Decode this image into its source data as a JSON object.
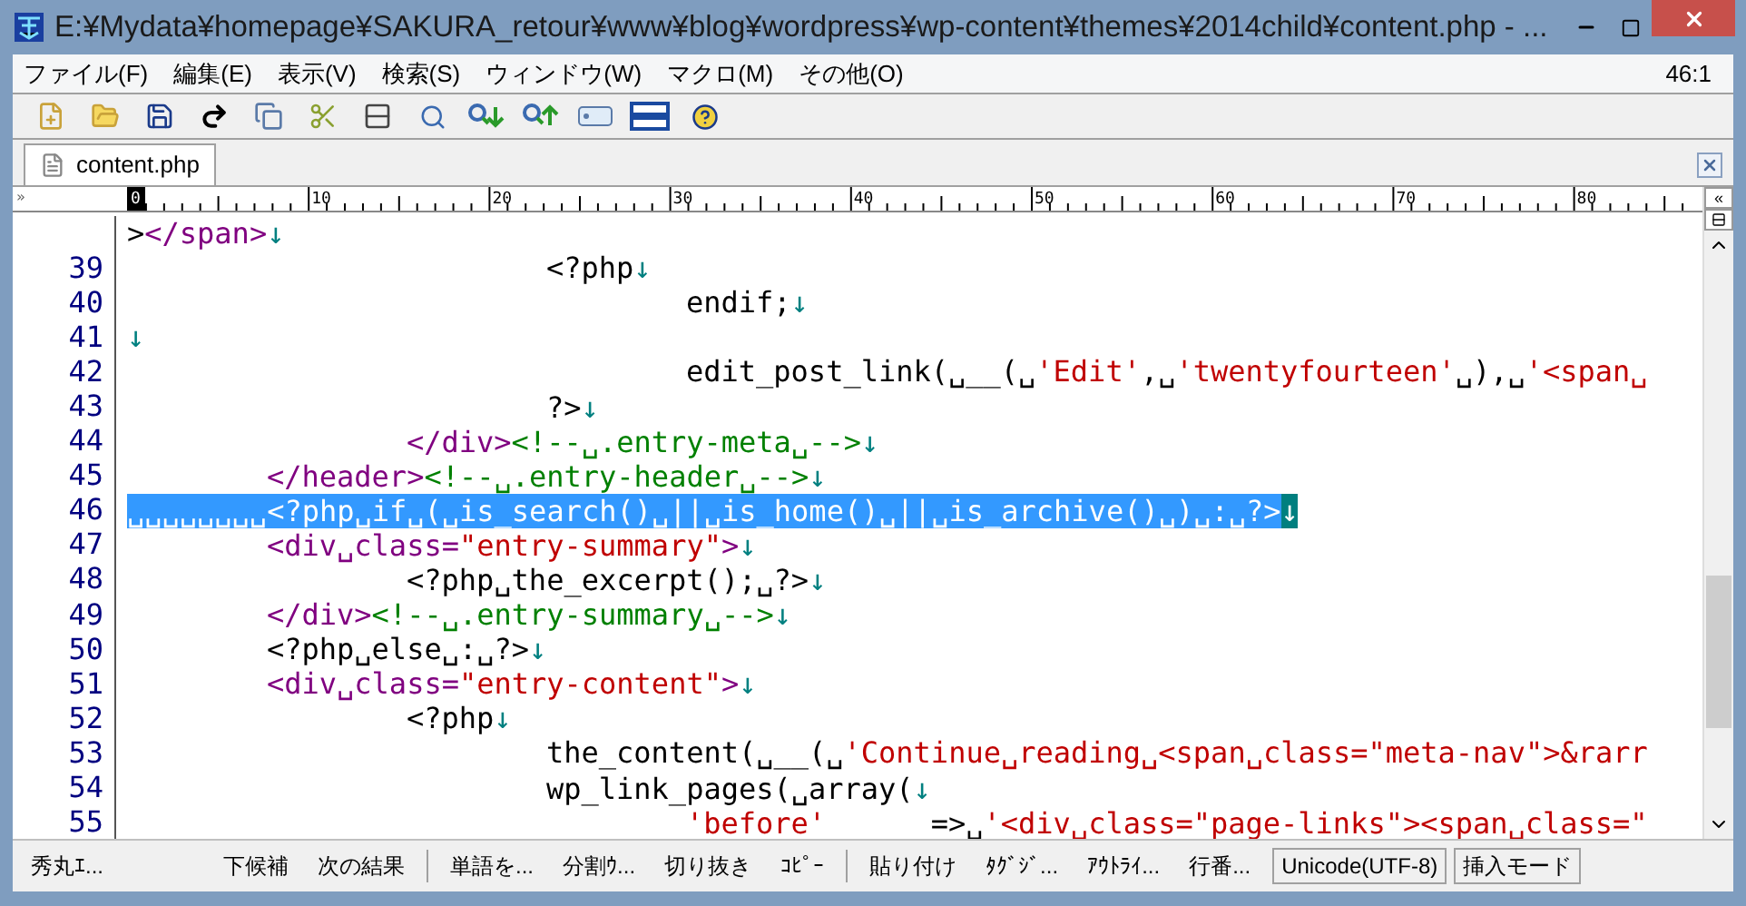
{
  "window": {
    "title": "E:¥Mydata¥homepage¥SAKURA_retour¥www¥blog¥wordpress¥wp-content¥themes¥2014child¥content.php  - ..."
  },
  "menu": [
    "ファイル(F)",
    "編集(E)",
    "表示(V)",
    "検索(S)",
    "ウィンドウ(W)",
    "マクロ(M)",
    "その他(O)"
  ],
  "cursor_position": "46:1",
  "tabs": [
    {
      "label": "content.php",
      "selected": true
    }
  ],
  "ruler": {
    "left_marker": "»",
    "collapse_marker": "«",
    "labels": [
      "0",
      "10",
      "20",
      "30",
      "40",
      "50",
      "60",
      "70",
      "80"
    ]
  },
  "lines": [
    {
      "selected": false,
      "segments": [
        {
          "kind": "plain",
          "text": ">"
        },
        {
          "kind": "tag",
          "text": "</span>"
        },
        {
          "kind": "eol",
          "text": "↓"
        }
      ]
    },
    {
      "number": "39",
      "selected": false,
      "segments": [
        {
          "kind": "tab"
        },
        {
          "kind": "tab"
        },
        {
          "kind": "tab"
        },
        {
          "kind": "plain",
          "text": "<?php"
        },
        {
          "kind": "eol",
          "text": "↓"
        }
      ]
    },
    {
      "number": "40",
      "selected": false,
      "segments": [
        {
          "kind": "tab"
        },
        {
          "kind": "tab"
        },
        {
          "kind": "tab"
        },
        {
          "kind": "tab"
        },
        {
          "kind": "plain",
          "text": "endif;"
        },
        {
          "kind": "eol",
          "text": "↓"
        }
      ]
    },
    {
      "number": "41",
      "selected": false,
      "segments": [
        {
          "kind": "eol",
          "text": "↓"
        }
      ]
    },
    {
      "number": "42",
      "selected": false,
      "segments": [
        {
          "kind": "tab"
        },
        {
          "kind": "tab"
        },
        {
          "kind": "tab"
        },
        {
          "kind": "tab"
        },
        {
          "kind": "plain",
          "text": "edit_post_link(␣__(␣"
        },
        {
          "kind": "string",
          "text": "'Edit'"
        },
        {
          "kind": "plain",
          "text": ",␣"
        },
        {
          "kind": "string",
          "text": "'twentyfourteen'"
        },
        {
          "kind": "plain",
          "text": "␣),␣"
        },
        {
          "kind": "string",
          "text": "'<span␣"
        }
      ]
    },
    {
      "number": "43",
      "selected": false,
      "segments": [
        {
          "kind": "tab"
        },
        {
          "kind": "tab"
        },
        {
          "kind": "tab"
        },
        {
          "kind": "plain",
          "text": "?>"
        },
        {
          "kind": "eol",
          "text": "↓"
        }
      ]
    },
    {
      "number": "44",
      "selected": false,
      "segments": [
        {
          "kind": "tab"
        },
        {
          "kind": "tab"
        },
        {
          "kind": "tag",
          "text": "</div>"
        },
        {
          "kind": "comment",
          "text": "<!--␣.entry-meta␣-->"
        },
        {
          "kind": "eol",
          "text": "↓"
        }
      ]
    },
    {
      "number": "45",
      "selected": false,
      "segments": [
        {
          "kind": "tab"
        },
        {
          "kind": "tag",
          "text": "</header>"
        },
        {
          "kind": "comment",
          "text": "<!--␣.entry-header␣-->"
        },
        {
          "kind": "eol",
          "text": "↓"
        }
      ]
    },
    {
      "number": "46",
      "selected": true,
      "segments": [
        {
          "kind": "plain",
          "text": "␣␣␣␣␣␣␣␣<?php␣if␣(␣is_search()␣||␣is_home()␣||␣is_archive()␣)␣:␣?>"
        },
        {
          "kind": "eol",
          "text": "↓"
        }
      ]
    },
    {
      "number": "47",
      "selected": false,
      "segments": [
        {
          "kind": "tab"
        },
        {
          "kind": "tag",
          "text": "<div␣class="
        },
        {
          "kind": "string",
          "text": "\"entry-summary\""
        },
        {
          "kind": "tag",
          "text": ">"
        },
        {
          "kind": "eol",
          "text": "↓"
        }
      ]
    },
    {
      "number": "48",
      "selected": false,
      "segments": [
        {
          "kind": "tab"
        },
        {
          "kind": "tab"
        },
        {
          "kind": "plain",
          "text": "<?php␣the_excerpt();␣?>"
        },
        {
          "kind": "eol",
          "text": "↓"
        }
      ]
    },
    {
      "number": "49",
      "selected": false,
      "segments": [
        {
          "kind": "tab"
        },
        {
          "kind": "tag",
          "text": "</div>"
        },
        {
          "kind": "comment",
          "text": "<!--␣.entry-summary␣-->"
        },
        {
          "kind": "eol",
          "text": "↓"
        }
      ]
    },
    {
      "number": "50",
      "selected": false,
      "segments": [
        {
          "kind": "tab"
        },
        {
          "kind": "plain",
          "text": "<?php␣else␣:␣?>"
        },
        {
          "kind": "eol",
          "text": "↓"
        }
      ]
    },
    {
      "number": "51",
      "selected": false,
      "segments": [
        {
          "kind": "tab"
        },
        {
          "kind": "tag",
          "text": "<div␣class="
        },
        {
          "kind": "string",
          "text": "\"entry-content\""
        },
        {
          "kind": "tag",
          "text": ">"
        },
        {
          "kind": "eol",
          "text": "↓"
        }
      ]
    },
    {
      "number": "52",
      "selected": false,
      "segments": [
        {
          "kind": "tab"
        },
        {
          "kind": "tab"
        },
        {
          "kind": "plain",
          "text": "<?php"
        },
        {
          "kind": "eol",
          "text": "↓"
        }
      ]
    },
    {
      "number": "53",
      "selected": false,
      "segments": [
        {
          "kind": "tab"
        },
        {
          "kind": "tab"
        },
        {
          "kind": "tab"
        },
        {
          "kind": "plain",
          "text": "the_content(␣__(␣"
        },
        {
          "kind": "string",
          "text": "'Continue␣reading␣<span␣class=\"meta-nav\">&rarr"
        }
      ]
    },
    {
      "number": "54",
      "selected": false,
      "segments": [
        {
          "kind": "tab"
        },
        {
          "kind": "tab"
        },
        {
          "kind": "tab"
        },
        {
          "kind": "plain",
          "text": "wp_link_pages(␣array("
        },
        {
          "kind": "eol",
          "text": "↓"
        }
      ]
    },
    {
      "number": "55",
      "selected": false,
      "segments": [
        {
          "kind": "tab"
        },
        {
          "kind": "tab"
        },
        {
          "kind": "tab"
        },
        {
          "kind": "tab"
        },
        {
          "kind": "string",
          "text": "'before'"
        },
        {
          "kind": "plain",
          "text": "      =>␣"
        },
        {
          "kind": "string",
          "text": "'<div␣class=\"page-links\"><span␣class=\""
        }
      ]
    }
  ],
  "status_bar": [
    {
      "kind": "button",
      "label": "秀丸ｴ..."
    },
    {
      "kind": "gap"
    },
    {
      "kind": "button",
      "label": "下候補"
    },
    {
      "kind": "button",
      "label": "次の結果"
    },
    {
      "kind": "separator"
    },
    {
      "kind": "button",
      "label": "単語を..."
    },
    {
      "kind": "button",
      "label": "分割ｳ..."
    },
    {
      "kind": "button",
      "label": "切り抜き"
    },
    {
      "kind": "button",
      "label": "ｺﾋﾟｰ"
    },
    {
      "kind": "separator"
    },
    {
      "kind": "button",
      "label": "貼り付け"
    },
    {
      "kind": "button",
      "label": "ﾀｸﾞｼﾞ..."
    },
    {
      "kind": "button",
      "label": "ｱｳﾄﾗｲ..."
    },
    {
      "kind": "button",
      "label": "行番..."
    },
    {
      "kind": "indicator",
      "label": "Unicode(UTF-8)"
    },
    {
      "kind": "indicator",
      "label": "挿入モード"
    }
  ]
}
